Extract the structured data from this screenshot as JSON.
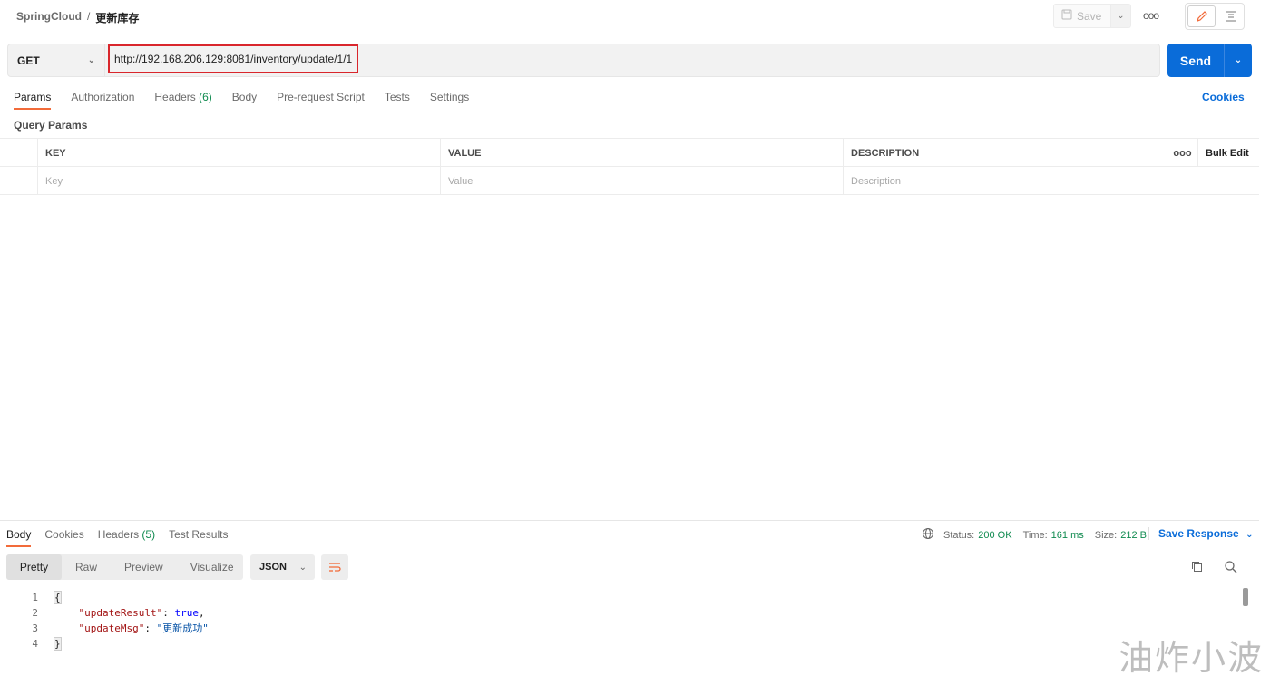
{
  "breadcrumb": {
    "collection": "SpringCloud",
    "separator": "/",
    "request": "更新库存"
  },
  "toolbar": {
    "save_label": "Save"
  },
  "request": {
    "method": "GET",
    "url": "http://192.168.206.129:8081/inventory/update/1/1",
    "send_label": "Send"
  },
  "tabs": [
    {
      "label": "Params"
    },
    {
      "label": "Authorization"
    },
    {
      "label": "Headers",
      "count": "(6)"
    },
    {
      "label": "Body"
    },
    {
      "label": "Pre-request Script"
    },
    {
      "label": "Tests"
    },
    {
      "label": "Settings"
    }
  ],
  "cookies_label": "Cookies",
  "query_params": {
    "title": "Query Params",
    "headers": {
      "key": "KEY",
      "value": "VALUE",
      "description": "DESCRIPTION",
      "bulk_edit": "Bulk Edit"
    },
    "placeholders": {
      "key": "Key",
      "value": "Value",
      "description": "Description"
    }
  },
  "response": {
    "tabs": [
      {
        "label": "Body"
      },
      {
        "label": "Cookies"
      },
      {
        "label": "Headers",
        "count": "(5)"
      },
      {
        "label": "Test Results"
      }
    ],
    "status_label": "Status:",
    "status_value": "200 OK",
    "time_label": "Time:",
    "time_value": "161 ms",
    "size_label": "Size:",
    "size_value": "212 B",
    "save_response_label": "Save Response",
    "view_modes": [
      "Pretty",
      "Raw",
      "Preview",
      "Visualize"
    ],
    "format": "JSON",
    "code_lines": [
      {
        "n": "1"
      },
      {
        "n": "2",
        "key": "\"updateResult\"",
        "value": "true"
      },
      {
        "n": "3",
        "key": "\"updateMsg\"",
        "value": "\"更新成功\""
      },
      {
        "n": "4"
      }
    ]
  },
  "watermark": "油炸小波",
  "colors": {
    "accent": "#f26b3a",
    "send": "#0a6cd9",
    "ok": "#0f8a4f",
    "highlight": "#d9262c"
  }
}
